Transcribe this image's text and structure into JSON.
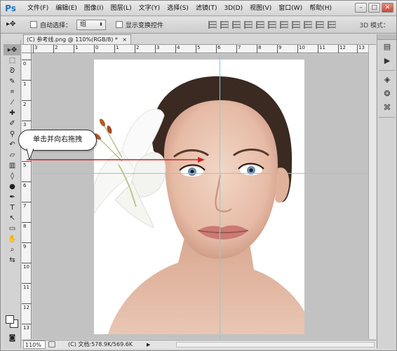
{
  "app": {
    "logo": "Ps"
  },
  "menu": [
    "文件(F)",
    "编辑(E)",
    "图像(I)",
    "图层(L)",
    "文字(Y)",
    "选择(S)",
    "滤镜(T)",
    "3D(D)",
    "视图(V)",
    "窗口(W)",
    "帮助(H)"
  ],
  "window_buttons": {
    "minimize": "–",
    "maximize": "□",
    "close": "✕"
  },
  "options": {
    "move_tool_glyph": "▸✥",
    "auto_select_label": "自动选择：",
    "auto_select_checked": false,
    "auto_select_value": "组",
    "show_transform_label": "显示变换控件",
    "show_transform_checked": false,
    "mode_3d_label": "3D 模式："
  },
  "document_tab": {
    "label": "(C) 参考线.png @ 110%(RGB/8) *",
    "close": "×"
  },
  "rulers": {
    "horizontal": [
      "3",
      "2",
      "1",
      "0",
      "1",
      "2",
      "3",
      "4",
      "5",
      "6",
      "7",
      "8",
      "9",
      "10",
      "11",
      "12",
      "13"
    ],
    "vertical": [
      "0",
      "1",
      "2",
      "3",
      "4",
      "5",
      "6",
      "7",
      "8",
      "9",
      "10",
      "11",
      "12",
      "13",
      "14"
    ]
  },
  "callout": {
    "text": "单击并向右拖拽"
  },
  "status": {
    "zoom": "110%",
    "doc_info": "(C) 文档:578.9K/569.6K",
    "arrow": "▶"
  },
  "icons": {
    "tools": [
      "move-icon",
      "marquee-icon",
      "lasso-icon",
      "quick-select-icon",
      "crop-icon",
      "eyedropper-icon",
      "healing-icon",
      "brush-icon",
      "clone-stamp-icon",
      "history-brush-icon",
      "eraser-icon",
      "gradient-icon",
      "blur-icon",
      "dodge-icon",
      "pen-icon",
      "type-icon",
      "path-select-icon",
      "rectangle-icon",
      "hand-icon",
      "zoom-icon"
    ],
    "right_panel": [
      "history-icon",
      "actions-icon",
      "layers-icon",
      "channels-icon",
      "paths-icon"
    ]
  },
  "colors": {
    "guide": "#7fd0e0",
    "arrow": "#cc2222",
    "accent": "#1c76c4"
  }
}
